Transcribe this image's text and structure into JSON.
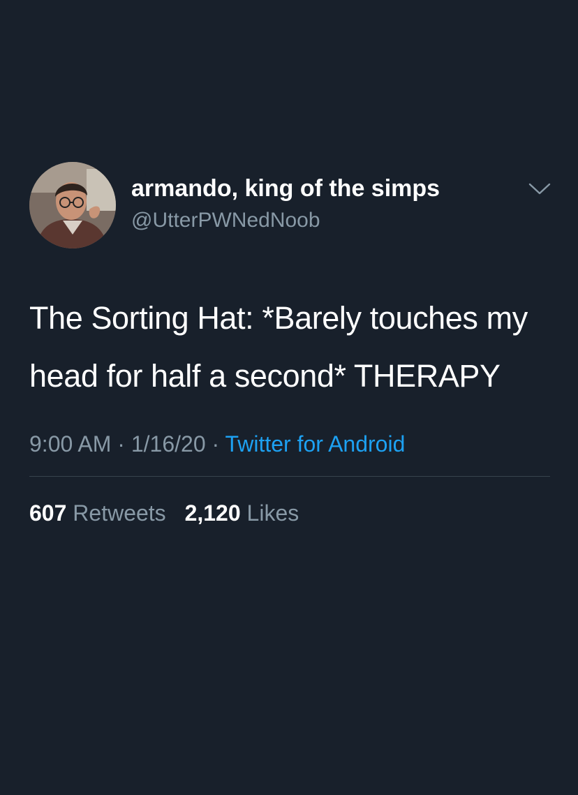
{
  "tweet": {
    "display_name": "armando, king of the simps",
    "handle": "@UtterPWNedNoob",
    "text": "The Sorting Hat: *Barely touches my head for half a second* THERAPY",
    "time": "9:00 AM",
    "date": "1/16/20",
    "separator": "·",
    "source": "Twitter for Android",
    "retweets_count": "607",
    "retweets_label": "Retweets",
    "likes_count": "2,120",
    "likes_label": "Likes"
  },
  "icons": {
    "avatar": "user-avatar-photo",
    "more_menu": "chevron-down-icon"
  },
  "colors": {
    "background": "#18202b",
    "primary_text": "#ffffff",
    "secondary_text": "#8899a6",
    "link": "#1da1f2",
    "divider": "#38444d"
  }
}
